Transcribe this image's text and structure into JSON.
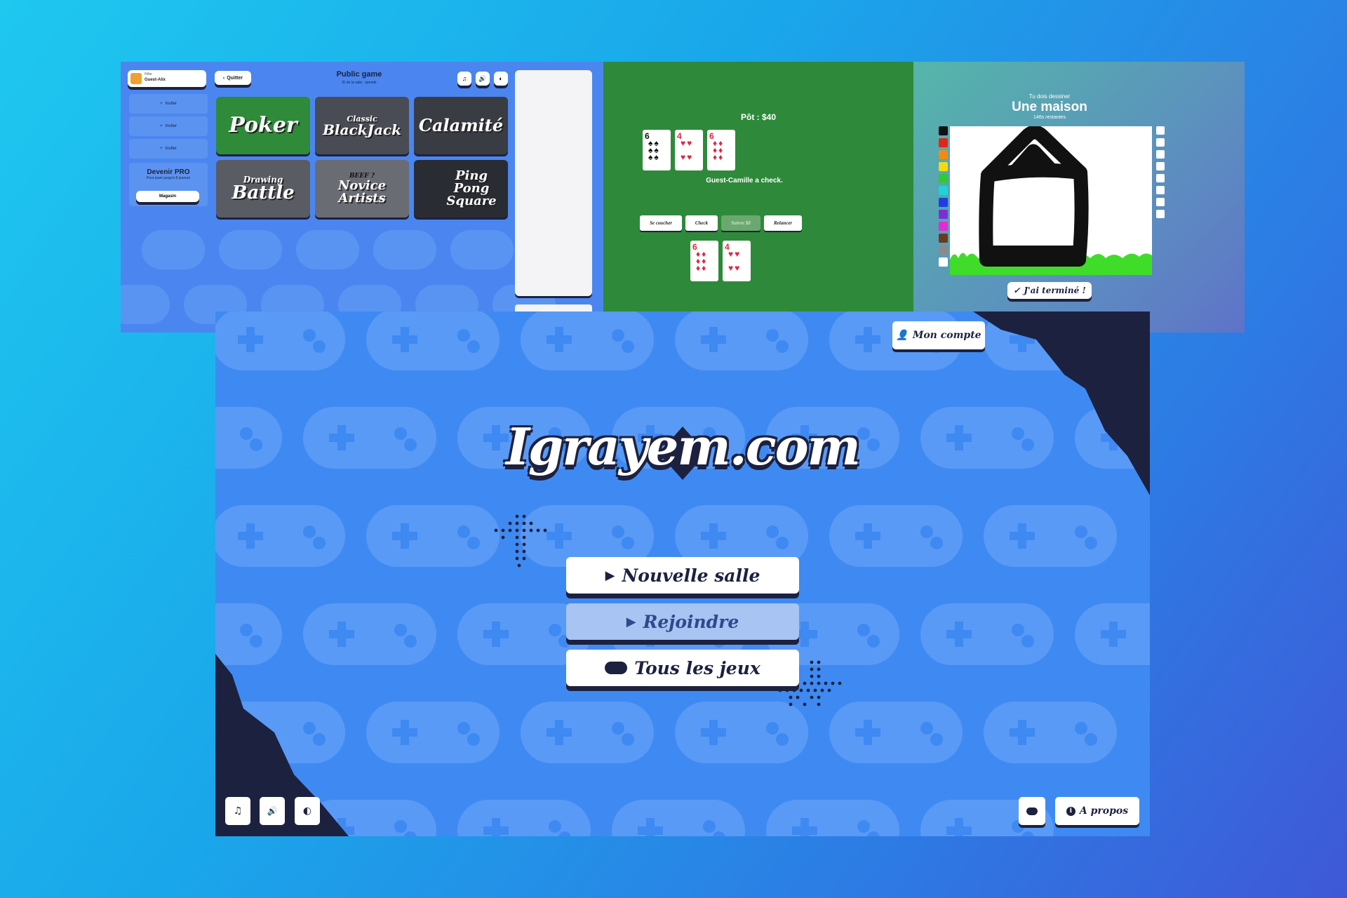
{
  "lobby": {
    "player_label": "Hôte",
    "player_name": "Guest-Alix",
    "quit_button": "Quitter",
    "room_title": "Public game",
    "room_id": "ID de la salle : kpmetk",
    "invite_label": "Inviter",
    "pro_title": "Devenir PRO",
    "pro_subtitle": "Pour jouer jusqu'à 8 joueurs",
    "shop_button": "Magasin",
    "games": [
      {
        "name": "Poker",
        "pre": "",
        "color": "#2f8a3a"
      },
      {
        "name": "BlackJack",
        "pre": "Classic",
        "color": "#4a4c55"
      },
      {
        "name": "Calamité",
        "pre": "",
        "color": "#3a3c44"
      },
      {
        "name": "Battle",
        "pre": "Drawing",
        "color": "#5a5c64"
      },
      {
        "name": "Novice Artists",
        "pre": "BEEF ?",
        "color": "#6a6c74"
      },
      {
        "name": "Ping Pong Square",
        "pre": "",
        "color": "#2a2c34"
      }
    ]
  },
  "poker": {
    "pot": "Pôt : $40",
    "message": "Guest-Camille a check.",
    "actions": [
      "Se coucher",
      "Check",
      "Suivre $0",
      "Relancer"
    ],
    "board": [
      {
        "rank": "6",
        "suit": "♠"
      },
      {
        "rank": "4",
        "suit": "♥"
      },
      {
        "rank": "6",
        "suit": "♦"
      }
    ],
    "hand": [
      {
        "rank": "6",
        "suit": "♦"
      },
      {
        "rank": "4",
        "suit": "♥"
      }
    ]
  },
  "drawing": {
    "prompt": "Tu dois dessiner",
    "word": "Une maison",
    "time_left": "146s restantes",
    "done_button": "J'ai terminé !",
    "palette": [
      "#111111",
      "#e3241b",
      "#f08c12",
      "#f5d90f",
      "#2fc93a",
      "#1fd3d8",
      "#1e3fe0",
      "#7b2fd6",
      "#e32ad5",
      "#6b3a1e",
      "#8a8a8a",
      "#ffffff"
    ]
  },
  "main": {
    "account_button": "Mon compte",
    "logo": "Igrayem.com",
    "new_room": "Nouvelle salle",
    "join": "Rejoindre",
    "all_games": "Tous les jeux",
    "about": "A propos"
  }
}
